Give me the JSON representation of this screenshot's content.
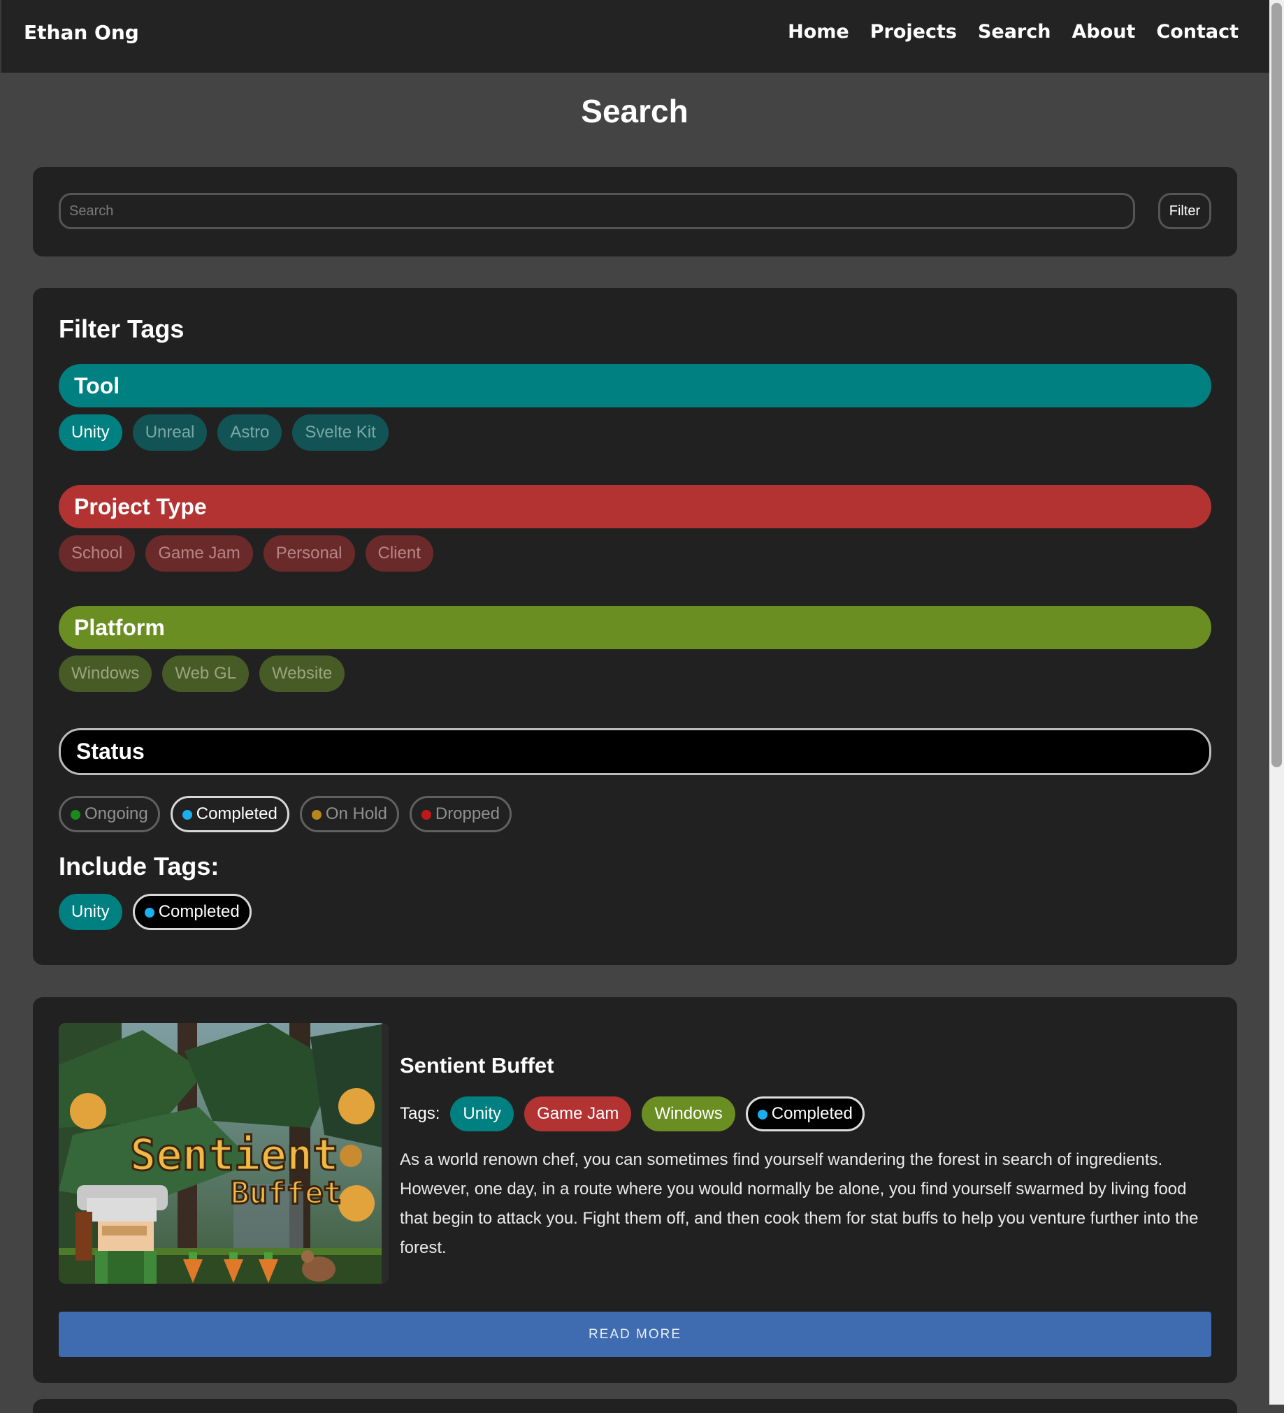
{
  "brand": "Ethan Ong",
  "nav": [
    {
      "label": "Home"
    },
    {
      "label": "Projects"
    },
    {
      "label": "Search"
    },
    {
      "label": "About"
    },
    {
      "label": "Contact"
    }
  ],
  "page_title": "Search",
  "search": {
    "placeholder": "Search",
    "value": "",
    "filter_label": "Filter"
  },
  "filter": {
    "title": "Filter Tags",
    "categories": {
      "tool": {
        "label": "Tool",
        "color": "#008080",
        "tags": [
          "Unity",
          "Unreal",
          "Astro",
          "Svelte Kit"
        ],
        "active": [
          "Unity"
        ]
      },
      "project_type": {
        "label": "Project Type",
        "color": "#b33333",
        "tags": [
          "School",
          "Game Jam",
          "Personal",
          "Client"
        ],
        "active": []
      },
      "platform": {
        "label": "Platform",
        "color": "#6b8e23",
        "tags": [
          "Windows",
          "Web GL",
          "Website"
        ],
        "active": []
      },
      "status": {
        "label": "Status",
        "color": "#000000",
        "tags": [
          {
            "label": "Ongoing",
            "dot_color": "#1a8a1a"
          },
          {
            "label": "Completed",
            "dot_color": "#1ab0f0"
          },
          {
            "label": "On Hold",
            "dot_color": "#b8861a"
          },
          {
            "label": "Dropped",
            "dot_color": "#c0181a"
          }
        ],
        "active": [
          "Completed"
        ]
      }
    },
    "include_title": "Include Tags:",
    "include": [
      {
        "label": "Unity"
      },
      {
        "label": "Completed",
        "dot_color": "#1ab0f0"
      }
    ]
  },
  "project": {
    "title": "Sentient Buffet",
    "thumbnail_text": [
      "Sentient",
      "Buffet"
    ],
    "tags_label": "Tags:",
    "tags": [
      {
        "label": "Unity"
      },
      {
        "label": "Game Jam"
      },
      {
        "label": "Windows"
      },
      {
        "label": "Completed",
        "dot_color": "#1ab0f0"
      }
    ],
    "description": "As a world renown chef, you can sometimes find yourself wandering the forest in search of ingredients. However, one day, in a route where you would normally be alone, you find yourself swarmed by living food that begin to attack you. Fight them off, and then cook them for stat buffs to help you venture further into the forest.",
    "read_more_label": "READ MORE"
  }
}
